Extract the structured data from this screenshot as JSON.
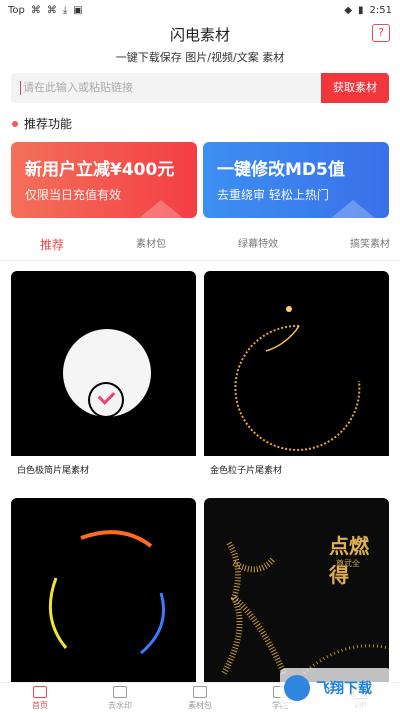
{
  "status_bar": {
    "carrier": "Top",
    "icons": [
      "sim-icon",
      "sim-icon",
      "download-icon",
      "font-icon"
    ],
    "time": "2:51"
  },
  "app": {
    "title": "闪电素材",
    "subtitle": "一键下载保存 图片/视频/文案 素材"
  },
  "search": {
    "placeholder": "请在此输入或粘贴链接",
    "button": "获取素材"
  },
  "section": {
    "title": "推荐功能"
  },
  "cards": [
    {
      "big": "新用户立减¥400元",
      "small": "仅限当日充值有效",
      "color": "#f43e45"
    },
    {
      "big": "一键修改MD5值",
      "small": "去重绕审 轻松上热门",
      "color": "#3a70ea"
    }
  ],
  "tabs": [
    "推荐",
    "素材包",
    "绿幕特效",
    "搞笑素材"
  ],
  "grid": [
    {
      "caption": "白色极简片尾素材"
    },
    {
      "caption": "金色粒子片尾素材"
    },
    {
      "caption": ""
    },
    {
      "caption": ""
    }
  ],
  "thumb_texts": {
    "gold_calligraphy": "点燃 得",
    "gold_small": "尊武全"
  },
  "bottom_nav": [
    "首页",
    "去水印",
    "素材包",
    "学院",
    "VIP"
  ],
  "watermark": {
    "text": "飞翔下载"
  },
  "colors": {
    "accent": "#e8484f",
    "button": "#f0373c",
    "blue": "#3a70ea"
  }
}
